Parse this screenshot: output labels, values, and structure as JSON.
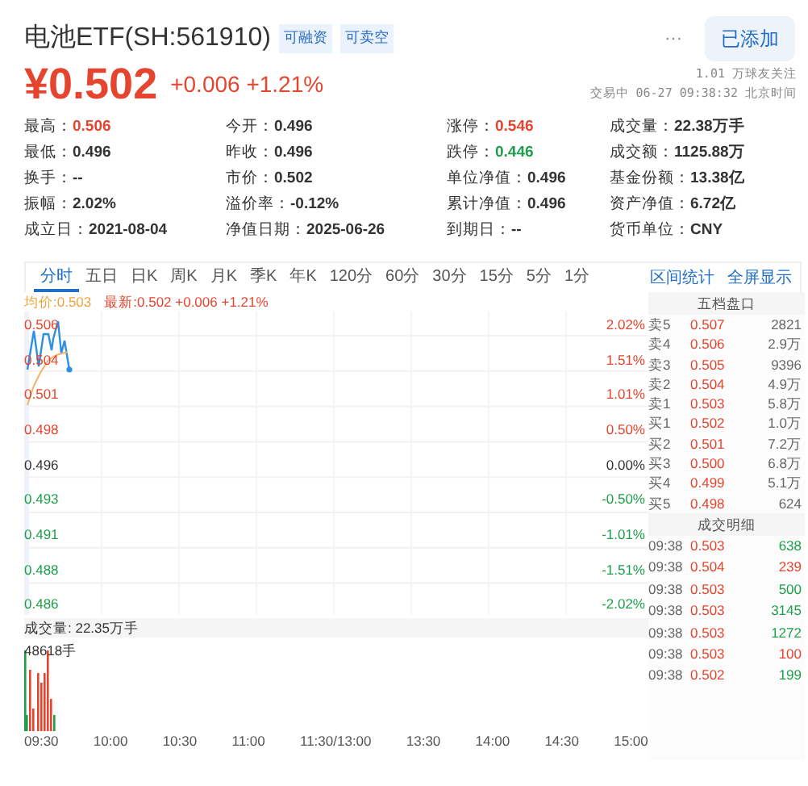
{
  "header": {
    "title": "电池ETF(SH:561910)",
    "tags": [
      "可融资",
      "可卖空"
    ],
    "more_button": "···",
    "follow_button": "已添加"
  },
  "quote": {
    "price": "¥0.502",
    "change": "+0.006",
    "percent": "+1.21%",
    "followers": "1.01 万球友关注",
    "status": "交易中 06-27 09:38:32 北京时间"
  },
  "stats": [
    [
      {
        "label": "最高：",
        "value": "0.506",
        "color": "#e5452e"
      },
      {
        "label": "今开：",
        "value": "0.496",
        "color": "#333333"
      },
      {
        "label": "涨停：",
        "value": "0.546",
        "color": "#e5452e"
      },
      {
        "label": "成交量：",
        "value": "22.38万手",
        "color": "#333333"
      }
    ],
    [
      {
        "label": "最低：",
        "value": "0.496",
        "color": "#333333"
      },
      {
        "label": "昨收：",
        "value": "0.496",
        "color": "#333333"
      },
      {
        "label": "跌停：",
        "value": "0.446",
        "color": "#1e9e4a"
      },
      {
        "label": "成交额：",
        "value": "1125.88万",
        "color": "#333333"
      }
    ],
    [
      {
        "label": "换手：",
        "value": "--",
        "color": "#333333"
      },
      {
        "label": "市价：",
        "value": "0.502",
        "color": "#333333"
      },
      {
        "label": "单位净值：",
        "value": "0.496",
        "color": "#333333"
      },
      {
        "label": "基金份额：",
        "value": "13.38亿",
        "color": "#333333"
      }
    ],
    [
      {
        "label": "振幅：",
        "value": "2.02%",
        "color": "#333333"
      },
      {
        "label": "溢价率：",
        "value": "-0.12%",
        "color": "#333333"
      },
      {
        "label": "累计净值：",
        "value": "0.496",
        "color": "#333333"
      },
      {
        "label": "资产净值：",
        "value": "6.72亿",
        "color": "#333333"
      }
    ],
    [
      {
        "label": "成立日：",
        "value": "2021-08-04",
        "color": "#333333"
      },
      {
        "label": "净值日期：",
        "value": "2025-06-26",
        "color": "#333333"
      },
      {
        "label": "到期日：",
        "value": "--",
        "color": "#333333"
      },
      {
        "label": "货币单位：",
        "value": "CNY",
        "color": "#333333"
      }
    ]
  ],
  "tabs": [
    {
      "label": "分时",
      "selected": true
    },
    {
      "label": "五日",
      "selected": false
    },
    {
      "label": "日K",
      "selected": false
    },
    {
      "label": "周K",
      "selected": false
    },
    {
      "label": "月K",
      "selected": false
    },
    {
      "label": "季K",
      "selected": false
    },
    {
      "label": "年K",
      "selected": false
    },
    {
      "label": "120分",
      "selected": false
    },
    {
      "label": "60分",
      "selected": false
    },
    {
      "label": "30分",
      "selected": false
    },
    {
      "label": "15分",
      "selected": false
    },
    {
      "label": "5分",
      "selected": false
    },
    {
      "label": "1分",
      "selected": false
    }
  ],
  "tools": [
    "区间统计",
    "全屏显示"
  ],
  "chart": {
    "average": "均价:0.503",
    "latest": "最新:0.502 +0.006 +1.21%",
    "price_labels": [
      {
        "text": "0.506",
        "color": "#e5452e"
      },
      {
        "text": "0.504",
        "color": "#e5452e"
      },
      {
        "text": "0.501",
        "color": "#e5452e"
      },
      {
        "text": "0.498",
        "color": "#e5452e"
      },
      {
        "text": "0.496",
        "color": "#333333"
      },
      {
        "text": "0.493",
        "color": "#1e9e4a"
      },
      {
        "text": "0.491",
        "color": "#1e9e4a"
      },
      {
        "text": "0.488",
        "color": "#1e9e4a"
      },
      {
        "text": "0.486",
        "color": "#1e9e4a"
      }
    ],
    "percent_labels": [
      {
        "text": "2.02%",
        "color": "#e5452e"
      },
      {
        "text": "1.51%",
        "color": "#e5452e"
      },
      {
        "text": "1.01%",
        "color": "#e5452e"
      },
      {
        "text": "0.50%",
        "color": "#e5452e"
      },
      {
        "text": "0.00%",
        "color": "#333333"
      },
      {
        "text": "-0.50%",
        "color": "#1e9e4a"
      },
      {
        "text": "-1.01%",
        "color": "#1e9e4a"
      },
      {
        "text": "-1.51%",
        "color": "#1e9e4a"
      },
      {
        "text": "-2.02%",
        "color": "#1e9e4a"
      }
    ],
    "volume_title": "成交量: 22.35万手",
    "volume_max": "48618手",
    "time_labels": [
      "09:30",
      "10:00",
      "10:30",
      "11:00",
      "11:30/13:00",
      "13:30",
      "14:00",
      "14:30",
      "15:00"
    ]
  },
  "order_book": {
    "title": "五档盘口",
    "rows": [
      {
        "label": "卖5",
        "price": "0.507",
        "volume": "2821"
      },
      {
        "label": "卖4",
        "price": "0.506",
        "volume": "2.9万"
      },
      {
        "label": "卖3",
        "price": "0.505",
        "volume": "9396"
      },
      {
        "label": "卖2",
        "price": "0.504",
        "volume": "4.9万"
      },
      {
        "label": "卖1",
        "price": "0.503",
        "volume": "5.8万"
      },
      {
        "label": "买1",
        "price": "0.502",
        "volume": "1.0万"
      },
      {
        "label": "买2",
        "price": "0.501",
        "volume": "7.2万"
      },
      {
        "label": "买3",
        "price": "0.500",
        "volume": "6.8万"
      },
      {
        "label": "买4",
        "price": "0.499",
        "volume": "5.1万"
      },
      {
        "label": "买5",
        "price": "0.498",
        "volume": "624"
      }
    ]
  },
  "trades": {
    "title": "成交明细",
    "rows": [
      {
        "time": "09:38",
        "price": "0.503",
        "volume": "638",
        "color": "#1e9e4a"
      },
      {
        "time": "09:38",
        "price": "0.504",
        "volume": "239",
        "color": "#e5452e"
      },
      {
        "time": "09:38",
        "price": "0.503",
        "volume": "500",
        "color": "#1e9e4a"
      },
      {
        "time": "09:38",
        "price": "0.503",
        "volume": "3145",
        "color": "#1e9e4a"
      },
      {
        "time": "09:38",
        "price": "0.503",
        "volume": "1272",
        "color": "#1e9e4a"
      },
      {
        "time": "09:38",
        "price": "0.503",
        "volume": "100",
        "color": "#e5452e"
      },
      {
        "time": "09:38",
        "price": "0.502",
        "volume": "199",
        "color": "#1e9e4a"
      }
    ]
  }
}
